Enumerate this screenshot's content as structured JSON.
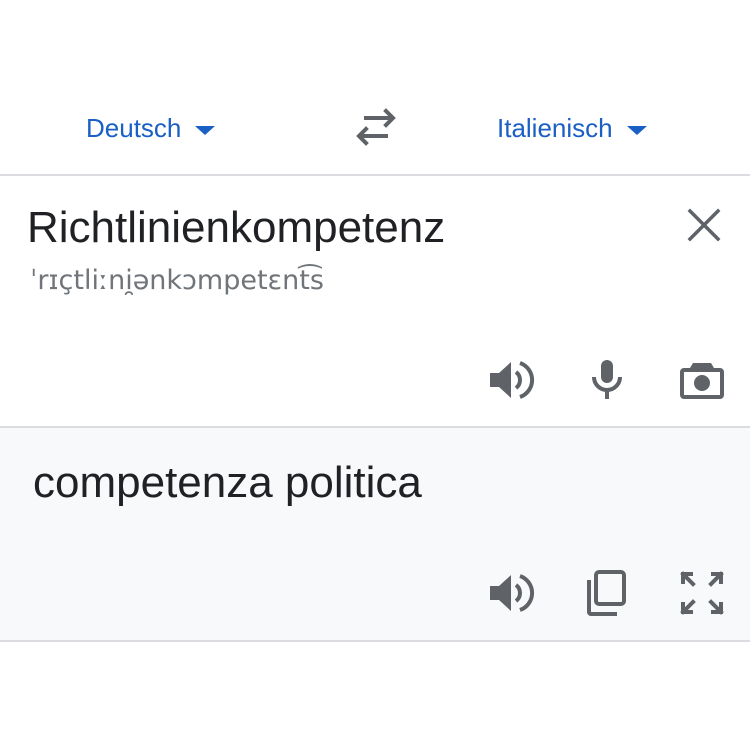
{
  "languages": {
    "source": "Deutsch",
    "target": "Italienisch"
  },
  "source": {
    "text": "Richtlinienkompetenz",
    "phonetic": "ˈrɪçtliːni̯ənkɔmpetɛnt͡s"
  },
  "target": {
    "text": "competenza politica"
  },
  "icons": {
    "swap": "swap-arrows-icon",
    "clear": "close-icon",
    "source_actions": [
      "speaker-icon",
      "microphone-icon",
      "camera-icon"
    ],
    "target_actions": [
      "speaker-icon",
      "copy-icon",
      "fullscreen-icon"
    ]
  },
  "colors": {
    "accent": "#1a5fc4",
    "icon": "#5f6368",
    "divider": "#dadce0",
    "target_bg": "#f8f9fa"
  }
}
